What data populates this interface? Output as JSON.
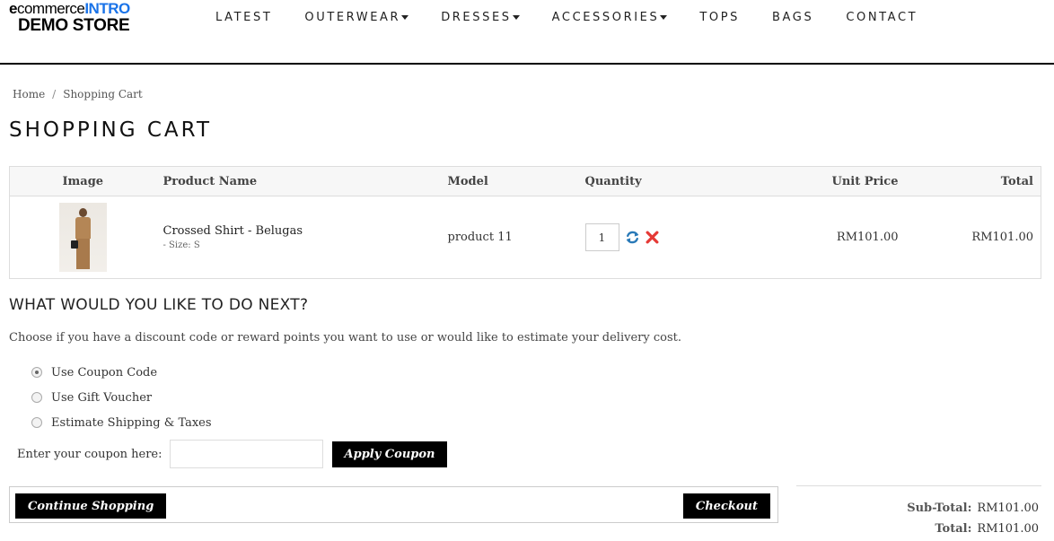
{
  "logo": {
    "brand_e": "e",
    "brand_top": "commerce",
    "brand_intro": "INTRO",
    "brand_bottom": "DEMO STORE"
  },
  "nav": [
    {
      "label": "LATEST",
      "dropdown": false
    },
    {
      "label": "OUTERWEAR",
      "dropdown": true
    },
    {
      "label": "DRESSES",
      "dropdown": true
    },
    {
      "label": "ACCESSORIES",
      "dropdown": true
    },
    {
      "label": "TOPS",
      "dropdown": false
    },
    {
      "label": "BAGS",
      "dropdown": false
    },
    {
      "label": "CONTACT",
      "dropdown": false
    }
  ],
  "breadcrumb": {
    "home": "Home",
    "separator": "/",
    "current": "Shopping Cart"
  },
  "page_title": "SHOPPING CART",
  "table": {
    "headers": {
      "image": "Image",
      "name": "Product Name",
      "model": "Model",
      "quantity": "Quantity",
      "unit_price": "Unit Price",
      "total": "Total"
    },
    "rows": [
      {
        "name": "Crossed Shirt - Belugas",
        "option": "- Size: S",
        "model": "product 11",
        "quantity": "1",
        "unit_price": "RM101.00",
        "total": "RM101.00"
      }
    ]
  },
  "next_section": {
    "title": "WHAT WOULD YOU LIKE TO DO NEXT?",
    "intro": "Choose if you have a discount code or reward points you want to use or would like to estimate your delivery cost.",
    "options": [
      {
        "label": "Use Coupon Code",
        "checked": true
      },
      {
        "label": "Use Gift Voucher",
        "checked": false
      },
      {
        "label": "Estimate Shipping & Taxes",
        "checked": false
      }
    ],
    "coupon_label": "Enter your coupon here:",
    "coupon_value": "",
    "apply_button": "Apply Coupon"
  },
  "actions": {
    "continue": "Continue Shopping",
    "checkout": "Checkout"
  },
  "totals": {
    "subtotal_label": "Sub-Total:",
    "subtotal_value": "RM101.00",
    "total_label": "Total:",
    "total_value": "RM101.00"
  },
  "colors": {
    "accent": "#1a73e8",
    "button_bg": "#000000",
    "remove_icon": "#e53935",
    "update_icon": "#2a7ab8"
  },
  "icons": {
    "update": "refresh-icon",
    "remove": "remove-x-icon"
  }
}
